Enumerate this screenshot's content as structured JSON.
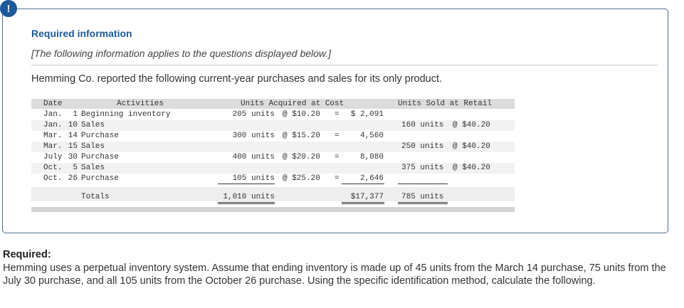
{
  "alert_icon": "!",
  "heading": "Required information",
  "note": "[The following information applies to the questions displayed below.]",
  "intro": "Hemming Co. reported the following current-year purchases and sales for its only product.",
  "table": {
    "headers": {
      "date": "Date",
      "activities": "Activities",
      "acquired": "Units Acquired at Cost",
      "sold": "Units Sold at Retail"
    },
    "rows": [
      {
        "month": "Jan.",
        "day": "1",
        "activity": "Beginning inventory",
        "acq_units": "205 units",
        "acq_at": "@ $10.20",
        "acq_eq": "=",
        "acq_total": "$ 2,091",
        "sold_units": "",
        "sold_at": ""
      },
      {
        "month": "Jan.",
        "day": "10",
        "activity": "Sales",
        "acq_units": "",
        "acq_at": "",
        "acq_eq": "",
        "acq_total": "",
        "sold_units": "160 units",
        "sold_at": "@ $40.20"
      },
      {
        "month": "Mar.",
        "day": "14",
        "activity": "Purchase",
        "acq_units": "300 units",
        "acq_at": "@ $15.20",
        "acq_eq": "=",
        "acq_total": "4,560",
        "sold_units": "",
        "sold_at": ""
      },
      {
        "month": "Mar.",
        "day": "15",
        "activity": "Sales",
        "acq_units": "",
        "acq_at": "",
        "acq_eq": "",
        "acq_total": "",
        "sold_units": "250 units",
        "sold_at": "@ $40.20"
      },
      {
        "month": "July",
        "day": "30",
        "activity": "Purchase",
        "acq_units": "400 units",
        "acq_at": "@ $20.20",
        "acq_eq": "=",
        "acq_total": "8,080",
        "sold_units": "",
        "sold_at": ""
      },
      {
        "month": "Oct.",
        "day": "5",
        "activity": "Sales",
        "acq_units": "",
        "acq_at": "",
        "acq_eq": "",
        "acq_total": "",
        "sold_units": "375 units",
        "sold_at": "@ $40.20"
      },
      {
        "month": "Oct.",
        "day": "26",
        "activity": "Purchase",
        "acq_units": "105 units",
        "acq_at": "@ $25.20",
        "acq_eq": "=",
        "acq_total": "2,646",
        "sold_units": "",
        "sold_at": ""
      }
    ],
    "totals": {
      "label": "Totals",
      "acq_units": "1,010 units",
      "acq_total": "$17,377",
      "sold_units": "785 units"
    }
  },
  "required": {
    "title": "Required:",
    "text": "Hemming uses a perpetual inventory system. Assume that ending inventory is made up of 45 units from the March 14 purchase, 75 units from the July 30 purchase, and all 105 units from the October 26 purchase. Using the specific identification method, calculate the following."
  }
}
